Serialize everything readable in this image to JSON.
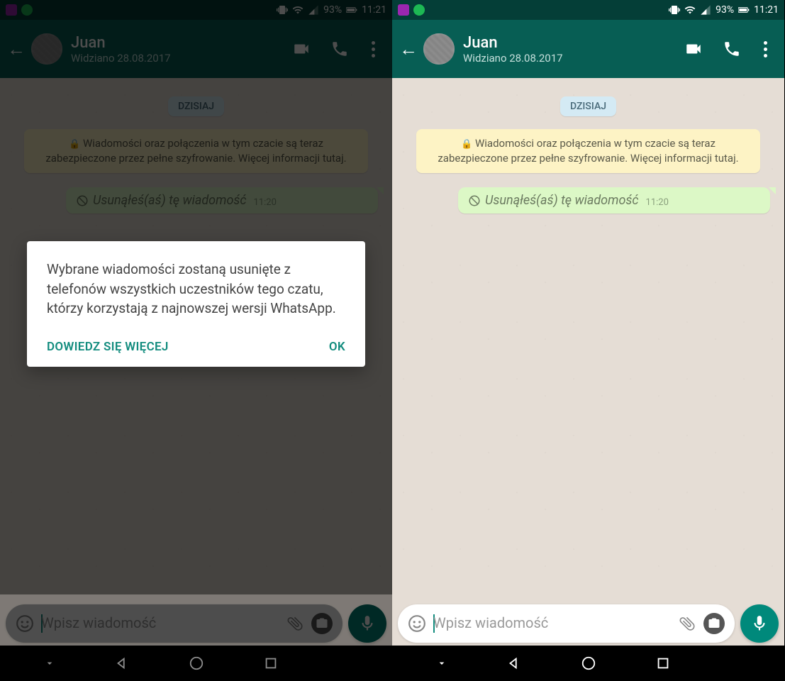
{
  "status": {
    "battery": "93%",
    "time": "11:21"
  },
  "header": {
    "name": "Juan",
    "lastSeen": "Widziano 28.08.2017"
  },
  "chat": {
    "dateChip": "DZISIAJ",
    "encryption": "Wiadomości oraz połączenia w tym czacie są teraz zabezpieczone przez pełne szyfrowanie. Więcej informacji tutaj.",
    "deletedMsg": "Usunąłeś(aś) tę wiadomość",
    "deletedTime": "11:20"
  },
  "input": {
    "placeholder": "Wpisz wiadomość"
  },
  "dialog": {
    "body": "Wybrane wiadomości zostaną usunięte z telefonów wszystkich uczestników tego czatu, którzy korzystają z najnowszej wersji WhatsApp.",
    "learnMore": "DOWIEDZ SIĘ WIĘCEJ",
    "ok": "OK"
  }
}
